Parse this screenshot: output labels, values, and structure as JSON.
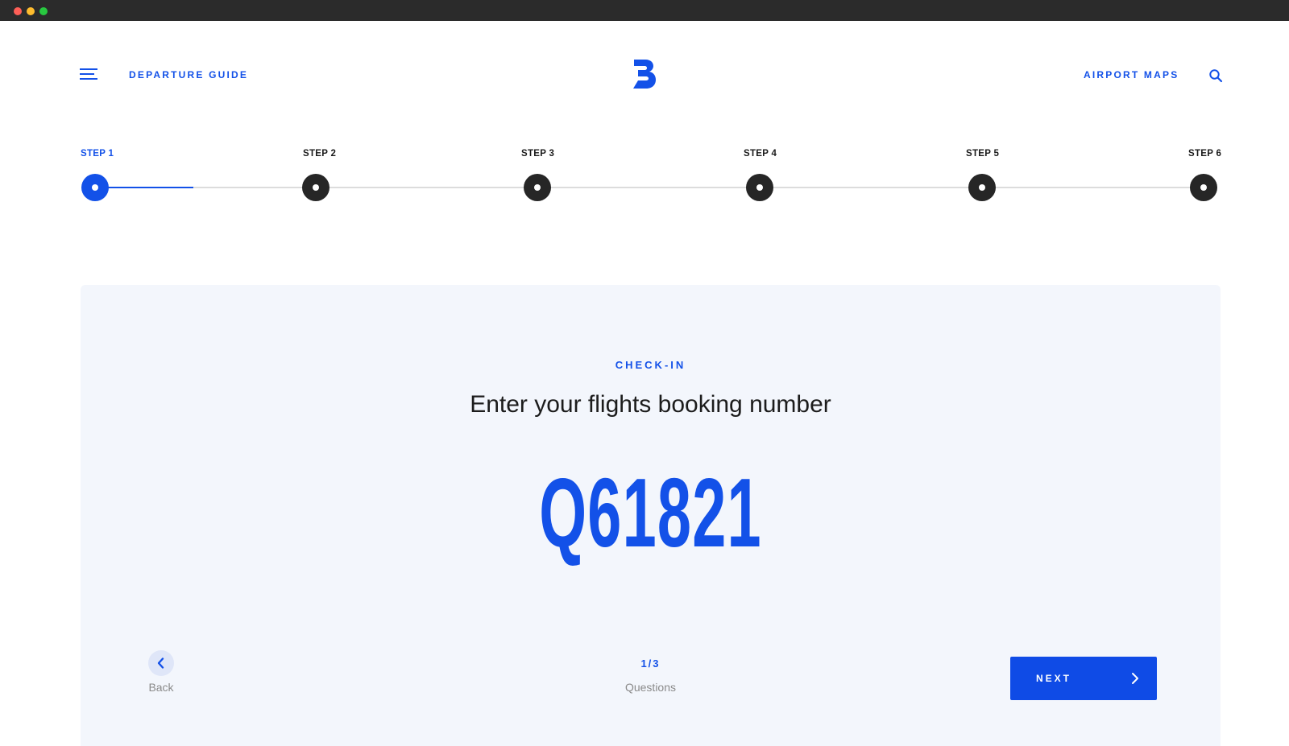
{
  "header": {
    "nav_left": "DEPARTURE GUIDE",
    "nav_right": "AIRPORT MAPS",
    "logo_icon": "brand-b-logo",
    "menu_icon": "hamburger-menu-icon",
    "search_icon": "search-icon"
  },
  "stepper": {
    "current_step": 1,
    "steps": [
      {
        "label": "STEP 1"
      },
      {
        "label": "STEP 2"
      },
      {
        "label": "STEP 3"
      },
      {
        "label": "STEP 4"
      },
      {
        "label": "STEP 5"
      },
      {
        "label": "STEP 6"
      }
    ]
  },
  "question_card": {
    "section": "CHECK-IN",
    "question": "Enter your flights booking number",
    "answer": "Q61821",
    "back_label": "Back",
    "progress": "1/3",
    "progress_caption": "Questions",
    "next_label": "NEXT"
  },
  "colors": {
    "accent": "#1351e8",
    "card_background": "#f3f6fc",
    "inactive_step": "#262626"
  }
}
